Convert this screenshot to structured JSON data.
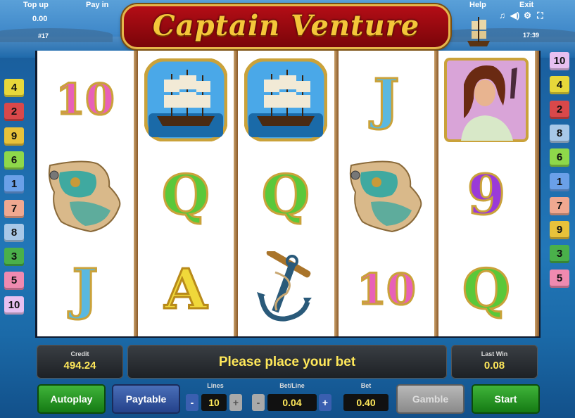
{
  "top": {
    "top_up": "Top up",
    "pay_in": "Pay in",
    "help": "Help",
    "exit": "Exit",
    "balance": "0.00",
    "game_id": "#17",
    "clock": "17:39",
    "icons": [
      "music-icon",
      "sound-icon",
      "settings-icon",
      "fullscreen-icon"
    ]
  },
  "title": "Captain Venture",
  "paylines": {
    "left": [
      {
        "n": "4",
        "color": "#e8d83a"
      },
      {
        "n": "2",
        "color": "#d9484a"
      },
      {
        "n": "9",
        "color": "#e8c23a"
      },
      {
        "n": "6",
        "color": "#8ed84a"
      },
      {
        "n": "1",
        "color": "#6aa0e8"
      },
      {
        "n": "7",
        "color": "#f0a890"
      },
      {
        "n": "8",
        "color": "#a8c8e8"
      },
      {
        "n": "3",
        "color": "#4ab04a"
      },
      {
        "n": "5",
        "color": "#f08ab0"
      },
      {
        "n": "10",
        "color": "#e8c0f0"
      }
    ],
    "right": [
      {
        "n": "10",
        "color": "#e8c0f0"
      },
      {
        "n": "4",
        "color": "#e8d83a"
      },
      {
        "n": "2",
        "color": "#d9484a"
      },
      {
        "n": "8",
        "color": "#a8c8e8"
      },
      {
        "n": "6",
        "color": "#8ed84a"
      },
      {
        "n": "1",
        "color": "#6aa0e8"
      },
      {
        "n": "7",
        "color": "#f0a890"
      },
      {
        "n": "9",
        "color": "#e8c23a"
      },
      {
        "n": "3",
        "color": "#4ab04a"
      },
      {
        "n": "5",
        "color": "#f08ab0"
      }
    ]
  },
  "reels": [
    [
      "10",
      "map",
      "J"
    ],
    [
      "ship",
      "Q",
      "A"
    ],
    [
      "ship",
      "Q",
      "anchor"
    ],
    [
      "J",
      "map",
      "10"
    ],
    [
      "lady",
      "9",
      "Q"
    ]
  ],
  "bottom": {
    "credit_label": "Credit",
    "credit_value": "494.24",
    "message": "Please place your bet",
    "last_win_label": "Last Win",
    "last_win_value": "0.08",
    "autoplay": "Autoplay",
    "paytable": "Paytable",
    "lines_label": "Lines",
    "lines_value": "10",
    "betline_label": "Bet/Line",
    "betline_value": "0.04",
    "bet_label": "Bet",
    "bet_value": "0.40",
    "gamble": "Gamble",
    "start": "Start",
    "minus": "-",
    "plus": "+"
  }
}
